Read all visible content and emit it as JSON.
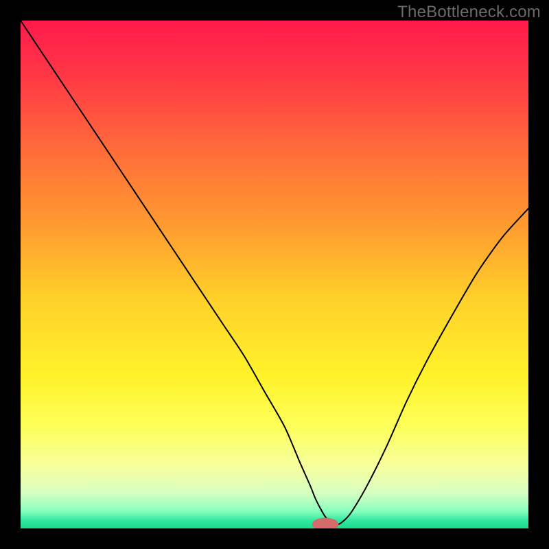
{
  "watermark": "TheBottleneck.com",
  "chart_data": {
    "type": "line",
    "title": "",
    "xlabel": "",
    "ylabel": "",
    "xlim": [
      0,
      100
    ],
    "ylim": [
      0,
      100
    ],
    "background_gradient": {
      "stops": [
        {
          "offset": 0.0,
          "color": "#ff1a4b"
        },
        {
          "offset": 0.1,
          "color": "#ff3545"
        },
        {
          "offset": 0.25,
          "color": "#ff6a3a"
        },
        {
          "offset": 0.4,
          "color": "#ff9a30"
        },
        {
          "offset": 0.55,
          "color": "#ffd12a"
        },
        {
          "offset": 0.7,
          "color": "#fff22a"
        },
        {
          "offset": 0.8,
          "color": "#fdff5a"
        },
        {
          "offset": 0.88,
          "color": "#f6ffa0"
        },
        {
          "offset": 0.93,
          "color": "#d6ffc0"
        },
        {
          "offset": 0.965,
          "color": "#8affc0"
        },
        {
          "offset": 0.985,
          "color": "#30e8a0"
        },
        {
          "offset": 1.0,
          "color": "#18db8a"
        }
      ]
    },
    "series": [
      {
        "name": "bottleneck-curve",
        "color": "#000000",
        "width": 2,
        "x": [
          0,
          4,
          8,
          12,
          16,
          20,
          24,
          28,
          32,
          36,
          40,
          44,
          48,
          52,
          55,
          57,
          58,
          59,
          60,
          61,
          62,
          63,
          65,
          68,
          72,
          76,
          80,
          85,
          90,
          95,
          100
        ],
        "y": [
          100,
          94,
          88,
          82,
          76,
          70,
          64,
          58,
          52,
          46,
          40,
          34,
          27,
          20,
          13,
          8.5,
          6,
          4,
          2.3,
          1.3,
          0.8,
          1.0,
          3,
          8,
          16,
          25,
          33,
          42,
          50.5,
          57.5,
          63
        ]
      }
    ],
    "marker": {
      "name": "optimal-point",
      "cx": 60,
      "cy": 0.8,
      "rx": 2.6,
      "ry": 1.3,
      "color": "#d46a6a"
    }
  }
}
